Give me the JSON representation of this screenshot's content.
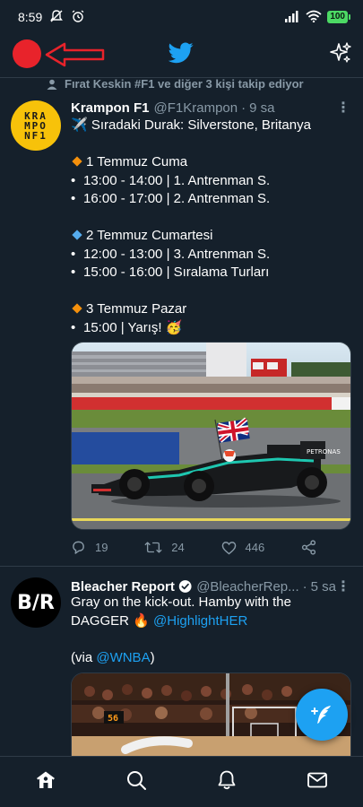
{
  "status_bar": {
    "time": "8:59",
    "battery": "100"
  },
  "header": {
    "logo_icon": "twitter-bird-icon",
    "sparkle_icon": "sparkle-icon"
  },
  "social_context": "Fırat Keskin #F1 ve diğer 3 kişi takip ediyor",
  "tweet1": {
    "name": "Krampon F1",
    "handle": "@F1Krampon",
    "time": "9 sa",
    "avatar_text": [
      "KRA",
      "MPO",
      "NF1"
    ],
    "lines": {
      "title": "✈️ Sıradaki Durak: Silverstone, Britanya",
      "day1": "1 Temmuz Cuma",
      "d1s1": "13:00 - 14:00 | 1. Antrenman S.",
      "d1s2": "16:00 - 17:00 | 2. Antrenman S.",
      "day2": "2 Temmuz Cumartesi",
      "d2s1": "12:00 - 13:00 | 3. Antrenman S.",
      "d2s2": "15:00 - 16:00 | Sıralama Turları",
      "day3": "3 Temmuz Pazar",
      "d3s1": "15:00 | Yarış! 🥳"
    },
    "colors": {
      "orange_diamond": "#f4900c",
      "blue_diamond": "#55acee"
    },
    "actions": {
      "replies": "19",
      "retweets": "24",
      "likes": "446"
    }
  },
  "tweet2": {
    "name": "Bleacher Report",
    "handle": "@BleacherRep...",
    "time": "5 sa",
    "avatar_text": "B/R",
    "line1": "Gray on the kick-out. Hamby with the",
    "line2_text": "DAGGER 🔥 ",
    "line2_link": "@HighlightHER",
    "line3_text": "(via ",
    "line3_link": "@WNBA",
    "line3_end": ")",
    "scoreboard": "56"
  },
  "bullet": "•",
  "dot": "·",
  "more": "⋮",
  "bottom_nav": [
    "home-icon",
    "search-icon",
    "notifications-icon",
    "messages-icon"
  ],
  "accent": "#1da1f2",
  "record_dot_color": "#e8232b"
}
